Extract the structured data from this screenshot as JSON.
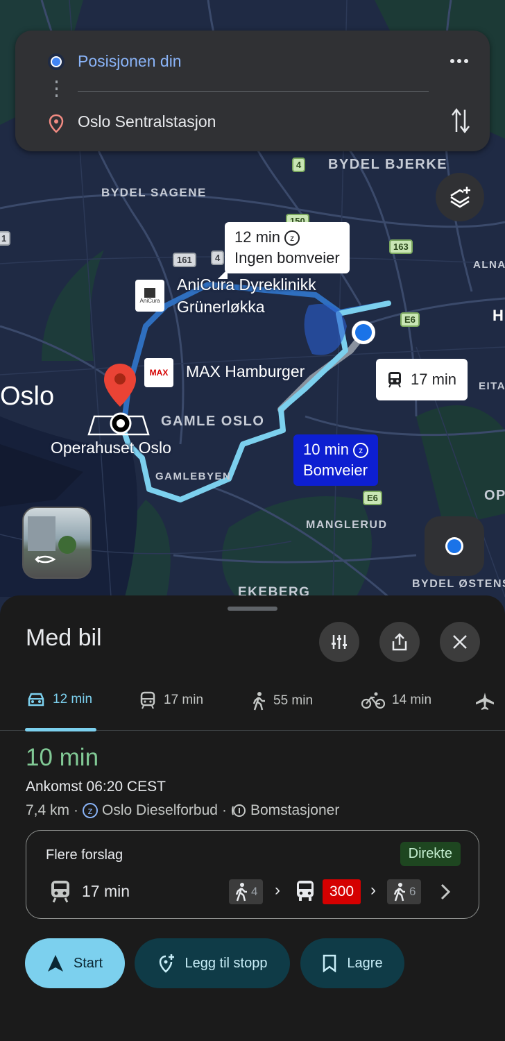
{
  "search": {
    "origin": "Posisjonen din",
    "destination": "Oslo Sentralstasjon"
  },
  "map": {
    "districts": [
      "BYDEL BJERKE",
      "BYDEL SAGENE",
      "GAMLE OSLO",
      "GAMLEBYEN",
      "MANGLERUD",
      "EKEBERG",
      "BYDEL ØSTENS",
      "ALNA",
      "EITA",
      "OP",
      "H"
    ],
    "city": "Oslo",
    "pois": {
      "anicura_line1": "AniCura Dyreklinikk",
      "anicura_line2": "Grünerløkka",
      "anicura_logo": "AniCura",
      "max": "MAX Hamburger",
      "max_logo": "MAX",
      "opera": "Operahuset Oslo"
    },
    "shields": [
      "4",
      "161",
      "4",
      "150",
      "163",
      "E6",
      "E6",
      "1"
    ],
    "callout_alt": {
      "time": "12 min",
      "note": "Ingen bomveier"
    },
    "callout_main": {
      "time": "10 min",
      "note": "Bomveier"
    },
    "callout_transit": {
      "time": "17 min"
    }
  },
  "sheet": {
    "title": "Med bil",
    "tabs": [
      {
        "mode": "car-icon",
        "label": "12 min"
      },
      {
        "mode": "train-icon",
        "label": "17 min"
      },
      {
        "mode": "walk-icon",
        "label": "55 min"
      },
      {
        "mode": "bike-icon",
        "label": "14 min"
      }
    ],
    "route": {
      "duration": "10 min",
      "arrival": "Ankomst 06:20 CEST",
      "distance": "7,4 km",
      "sep": "·",
      "zone": "Oslo Dieselforbud",
      "tolls": "Bomstasjoner"
    },
    "suggestion": {
      "title": "Flere forslag",
      "badge": "Direkte",
      "time": "17 min",
      "walk1": "4",
      "bus": "300",
      "walk2": "6",
      "chev": "›"
    },
    "buttons": {
      "start": "Start",
      "add_stop": "Legg til stopp",
      "save": "Lagre"
    }
  },
  "colors": {
    "route": "#7cd0ee",
    "accent_green": "#81c995",
    "bus_red": "#d50000",
    "toll_blue": "#0d1fd1"
  }
}
